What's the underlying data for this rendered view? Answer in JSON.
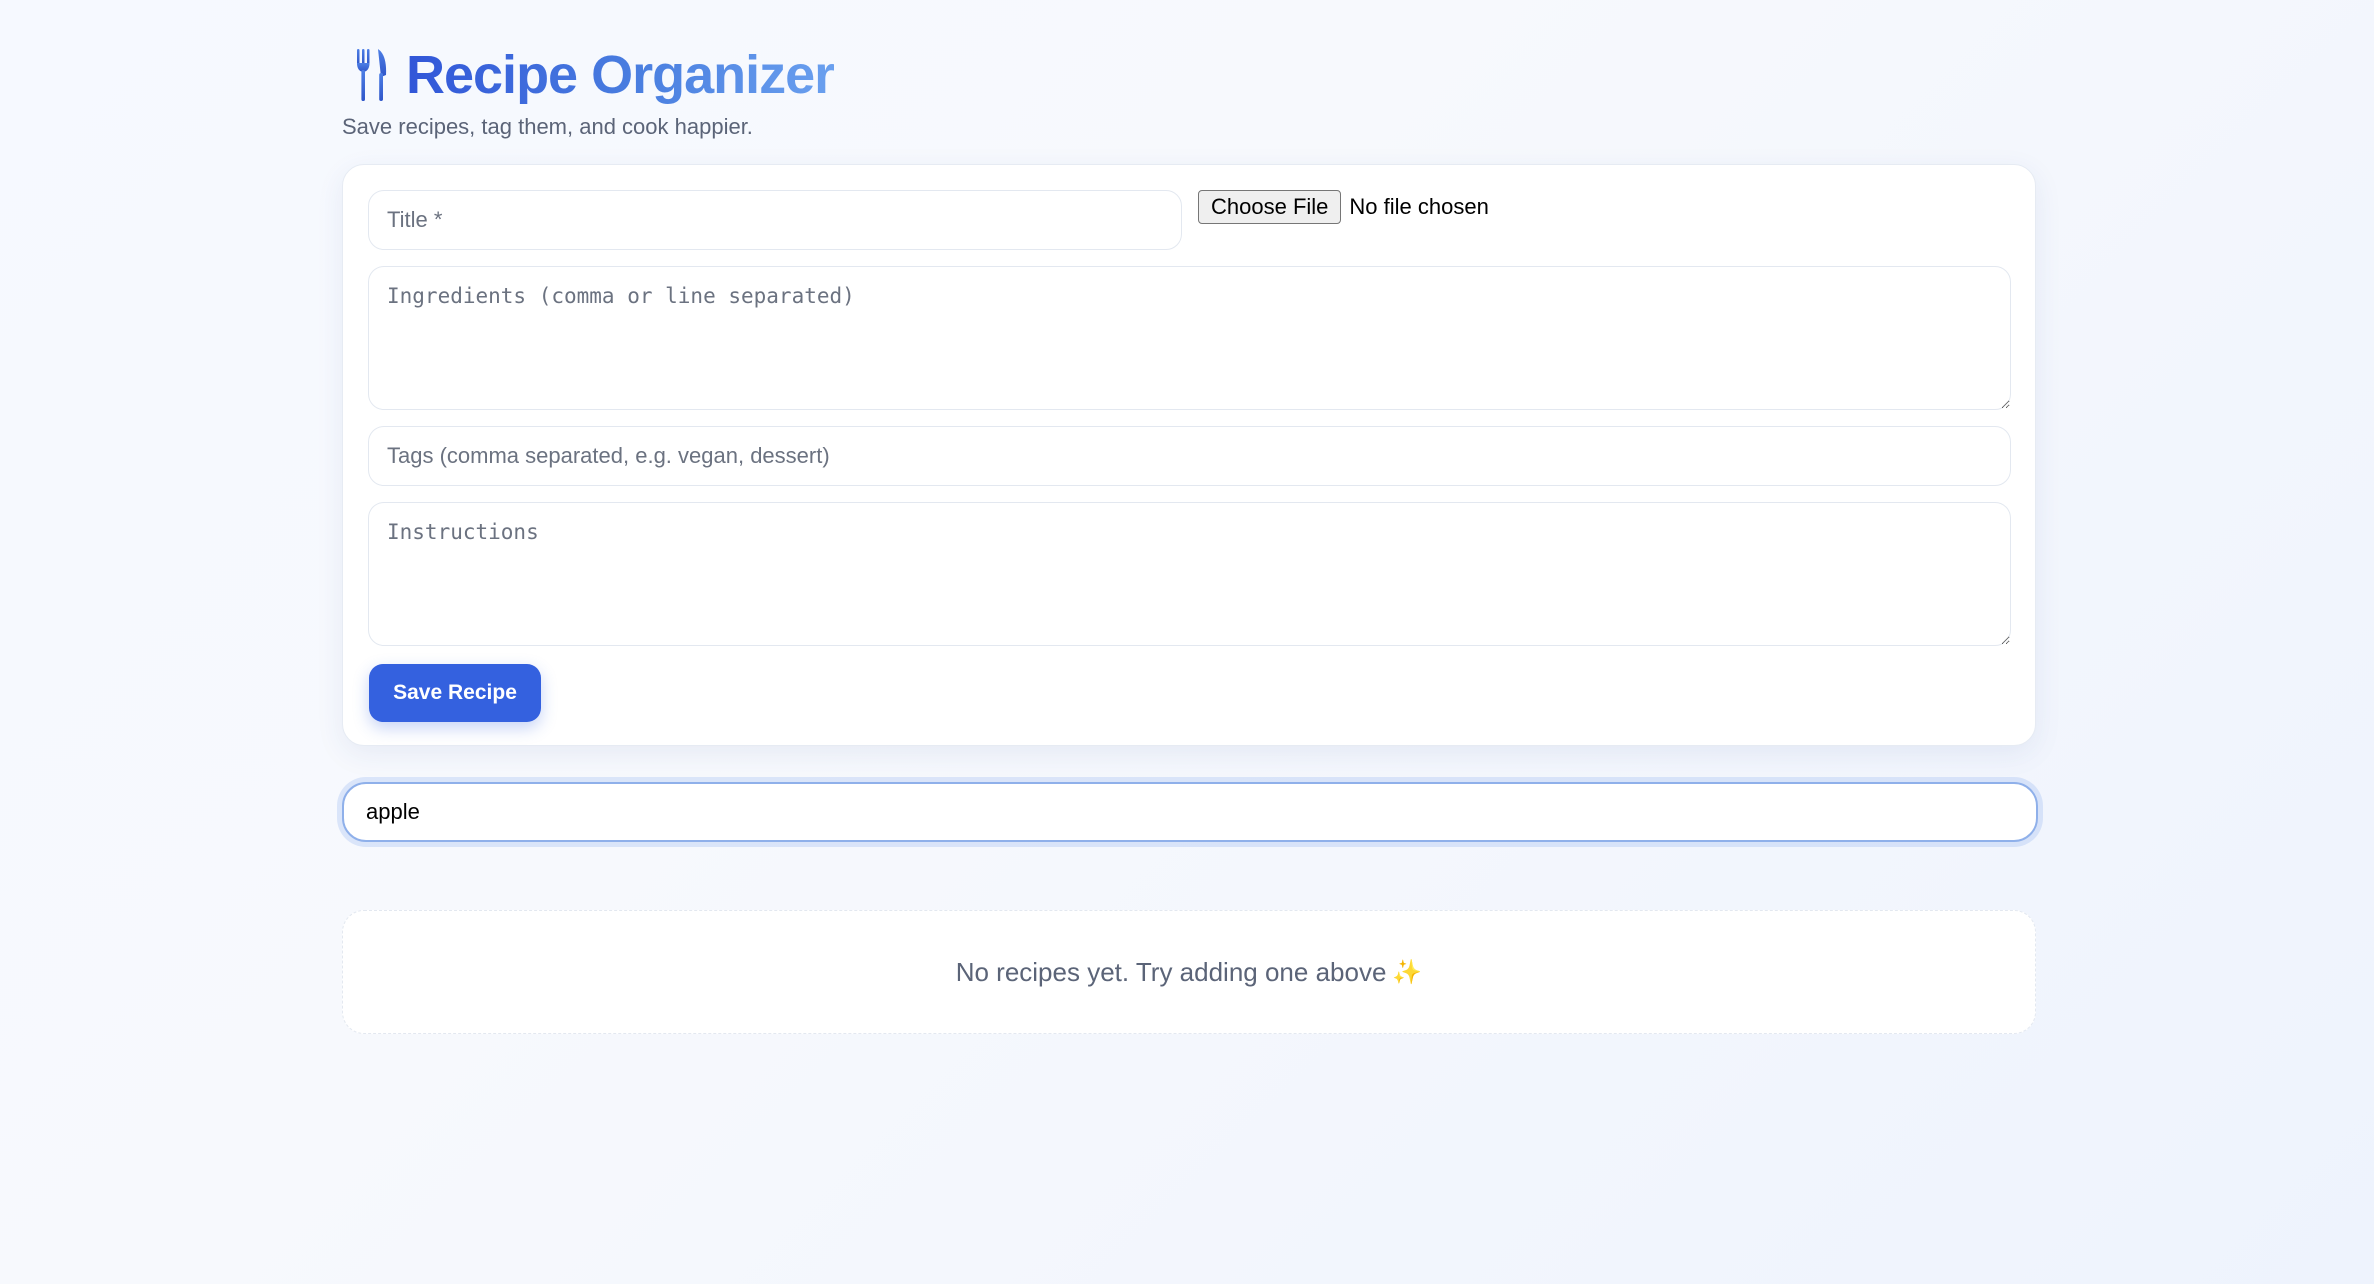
{
  "header": {
    "title": "Recipe Organizer",
    "subtitle": "Save recipes, tag them, and cook happier.",
    "icon": "fork-knife-icon"
  },
  "form": {
    "title_placeholder": "Title *",
    "title_value": "",
    "file_button_label": "Choose File",
    "file_status": "No file chosen",
    "ingredients_placeholder": "Ingredients (comma or line separated)",
    "tags_placeholder": "Tags (comma separated, e.g. vegan, dessert)",
    "instructions_placeholder": "Instructions",
    "save_label": "Save Recipe"
  },
  "search": {
    "value": "apple",
    "placeholder": ""
  },
  "empty_state": {
    "message": "No recipes yet. Try adding one above",
    "emoji": "✨"
  },
  "colors": {
    "accent": "#3461df",
    "title_gradient_start": "#3156d8",
    "title_gradient_end": "#6aa0ef"
  }
}
